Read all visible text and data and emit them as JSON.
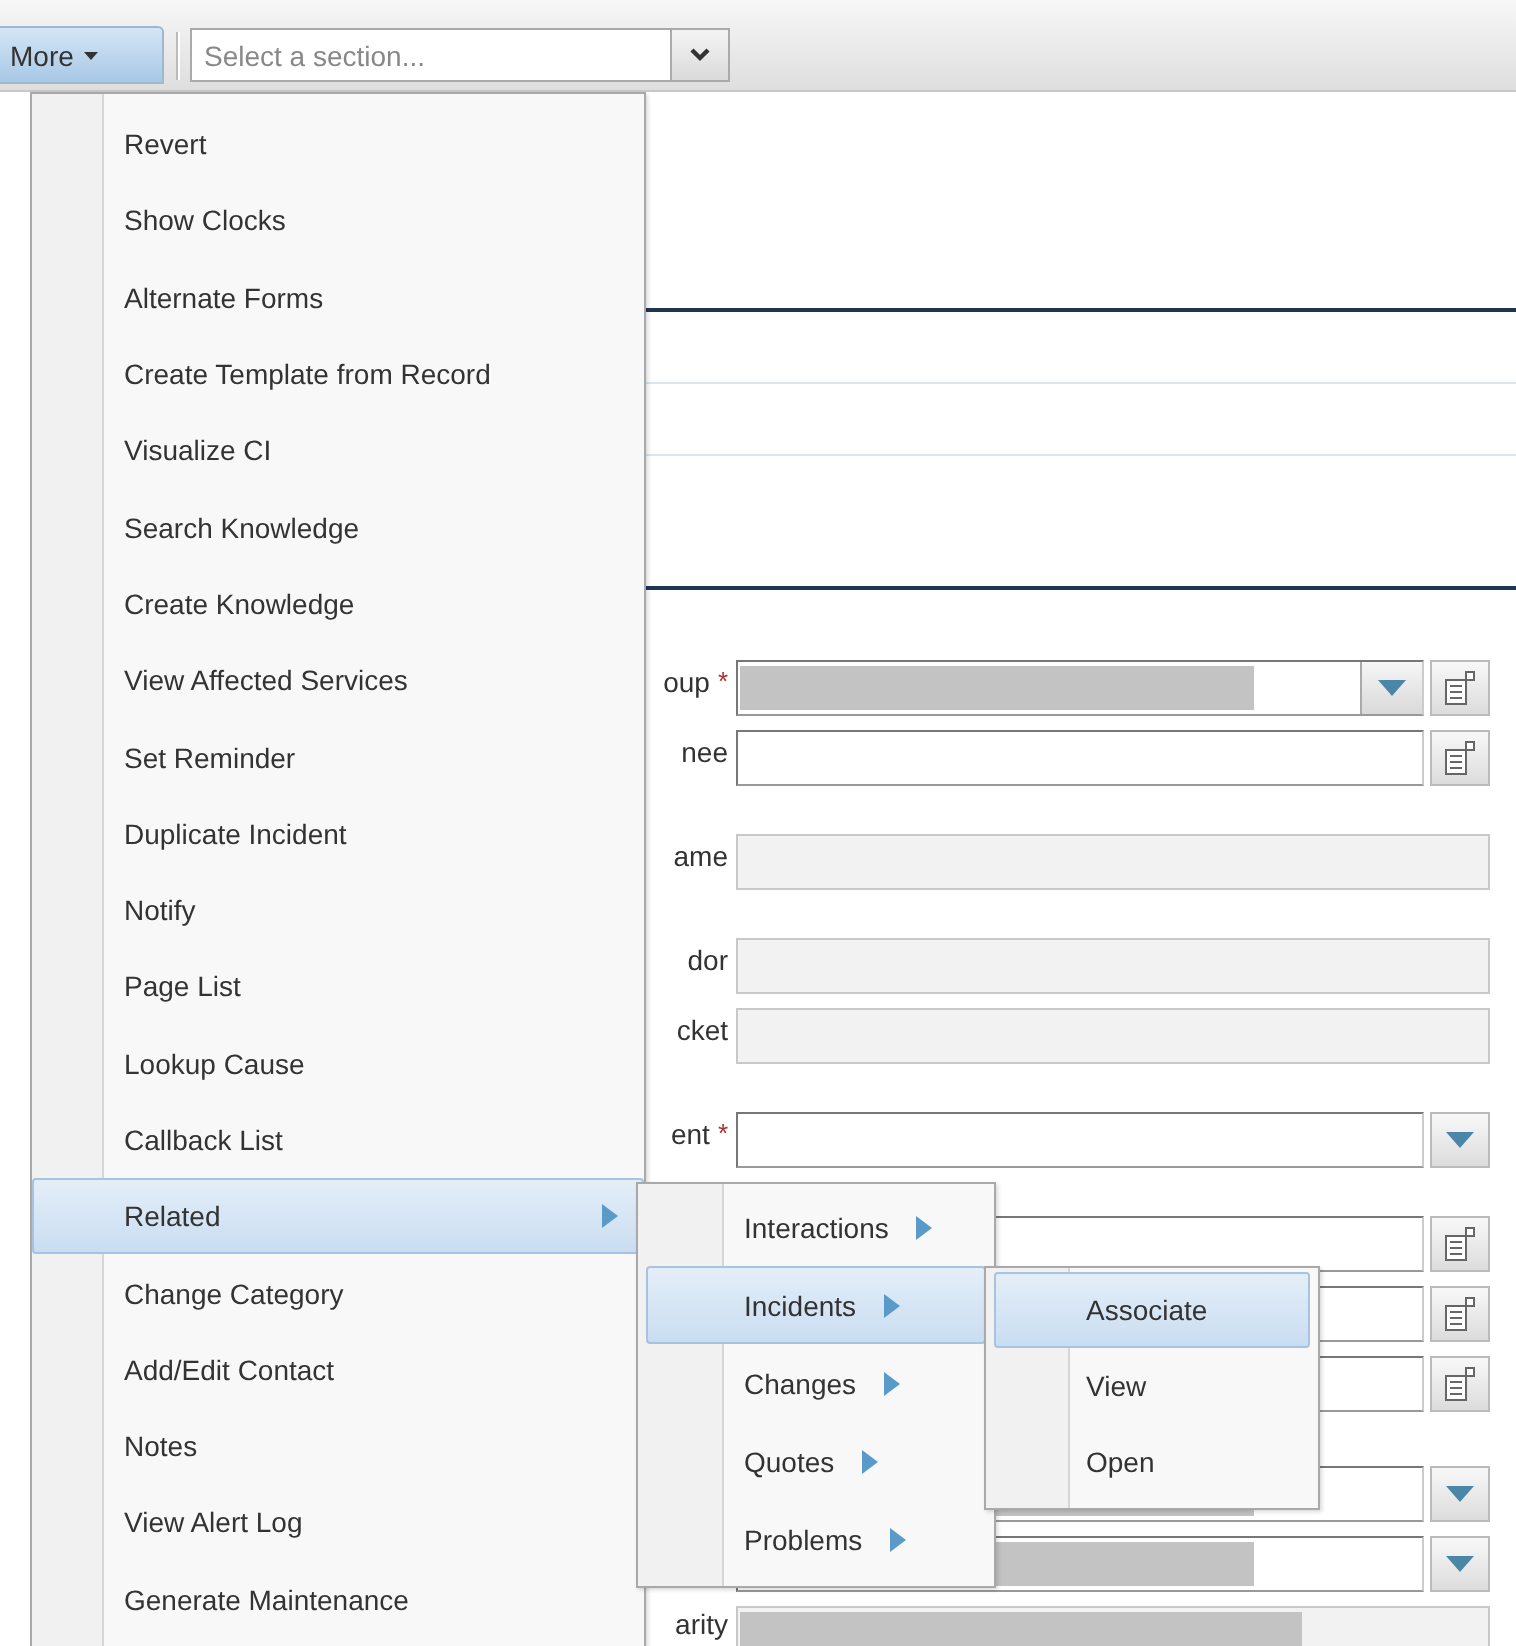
{
  "toolbar": {
    "more_button": {
      "label": "More"
    },
    "section_select": {
      "placeholder": "Select a section..."
    }
  },
  "form": {
    "groups": [
      [
        {
          "label": "oup",
          "required_mark": "*",
          "kind": "dropdown_lookup",
          "redacted": true
        },
        {
          "label": "nee",
          "kind": "lookup",
          "redacted": false
        }
      ],
      [
        {
          "label": "ame",
          "kind": "readonly",
          "redacted": false
        }
      ],
      [
        {
          "label": "dor",
          "kind": "readonly",
          "redacted": false
        },
        {
          "label": "cket",
          "kind": "readonly",
          "redacted": false
        }
      ],
      [
        {
          "label": "ent",
          "required_mark": "*",
          "kind": "dropdown",
          "redacted": false
        }
      ],
      [
        {
          "kind": "lookup",
          "redacted": false
        },
        {
          "kind": "lookup",
          "redacted": false
        },
        {
          "kind": "lookup",
          "redacted": false
        }
      ],
      [
        {
          "kind": "dropdown",
          "redacted": true
        },
        {
          "kind": "dropdown",
          "redacted": true
        },
        {
          "label": "arity",
          "kind": "readonly",
          "redacted": true
        }
      ]
    ]
  },
  "more_menu": {
    "items": [
      {
        "label": "Revert",
        "selected": false,
        "has_submenu": false
      },
      {
        "label": "Show Clocks",
        "selected": false,
        "has_submenu": false
      },
      {
        "label": "Alternate Forms",
        "selected": false,
        "has_submenu": false
      },
      {
        "label": "Create Template from Record",
        "selected": false,
        "has_submenu": false
      },
      {
        "label": "Visualize CI",
        "selected": false,
        "has_submenu": false
      },
      {
        "label": "Search Knowledge",
        "selected": false,
        "has_submenu": false
      },
      {
        "label": "Create Knowledge",
        "selected": false,
        "has_submenu": false
      },
      {
        "label": "View Affected Services",
        "selected": false,
        "has_submenu": false
      },
      {
        "label": "Set Reminder",
        "selected": false,
        "has_submenu": false
      },
      {
        "label": "Duplicate Incident",
        "selected": false,
        "has_submenu": false
      },
      {
        "label": "Notify",
        "selected": false,
        "has_submenu": false
      },
      {
        "label": "Page List",
        "selected": false,
        "has_submenu": false
      },
      {
        "label": "Lookup Cause",
        "selected": false,
        "has_submenu": false
      },
      {
        "label": "Callback List",
        "selected": false,
        "has_submenu": false
      },
      {
        "label": "Related",
        "selected": true,
        "has_submenu": true
      },
      {
        "label": "Change Category",
        "selected": false,
        "has_submenu": false
      },
      {
        "label": "Add/Edit Contact",
        "selected": false,
        "has_submenu": false
      },
      {
        "label": "Notes",
        "selected": false,
        "has_submenu": false
      },
      {
        "label": "View Alert Log",
        "selected": false,
        "has_submenu": false
      },
      {
        "label": "Generate Maintenance",
        "selected": false,
        "has_submenu": false
      }
    ]
  },
  "related_submenu": {
    "items": [
      {
        "label": "Interactions",
        "selected": false,
        "has_submenu": true
      },
      {
        "label": "Incidents",
        "selected": true,
        "has_submenu": true
      },
      {
        "label": "Changes",
        "selected": false,
        "has_submenu": true
      },
      {
        "label": "Quotes",
        "selected": false,
        "has_submenu": true
      },
      {
        "label": "Problems",
        "selected": false,
        "has_submenu": true
      }
    ]
  },
  "incidents_submenu": {
    "items": [
      {
        "label": "Associate",
        "selected": true,
        "has_submenu": false
      },
      {
        "label": "View",
        "selected": false,
        "has_submenu": false
      },
      {
        "label": "Open",
        "selected": false,
        "has_submenu": false
      }
    ]
  }
}
